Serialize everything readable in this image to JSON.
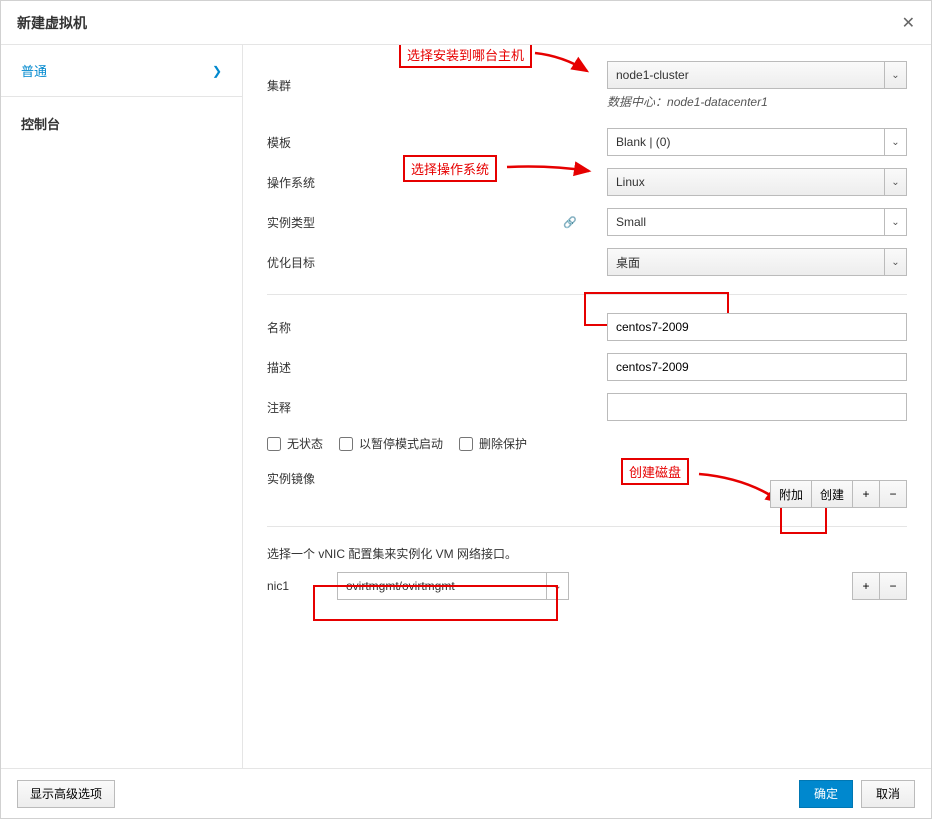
{
  "dialog": {
    "title": "新建虚拟机"
  },
  "sidebar": {
    "items": [
      {
        "label": "普通",
        "active": true
      },
      {
        "label": "控制台",
        "active": false
      }
    ]
  },
  "annotations": {
    "cluster_hint": "选择安装到哪台主机",
    "os_hint": "选择操作系统",
    "disk_hint": "创建磁盘"
  },
  "form": {
    "cluster_label": "集群",
    "cluster_value": "node1-cluster",
    "datacenter_label": "数据中心：",
    "datacenter_value": "node1-datacenter1",
    "template_label": "模板",
    "template_value": "Blank |  (0)",
    "os_label": "操作系统",
    "os_value": "Linux",
    "instance_type_label": "实例类型",
    "instance_type_value": "Small",
    "optimize_label": "优化目标",
    "optimize_value": "桌面",
    "name_label": "名称",
    "name_value": "centos7-2009",
    "desc_label": "描述",
    "desc_value": "centos7-2009",
    "comment_label": "注释",
    "comment_value": "",
    "stateless_label": "无状态",
    "pause_label": "以暂停模式启动",
    "delete_protect_label": "删除保护",
    "instance_image_label": "实例镜像",
    "attach_btn": "附加",
    "create_btn": "创建",
    "nic_desc": "选择一个 vNIC 配置集来实例化 VM 网络接口。",
    "nic1_label": "nic1",
    "nic1_value": "ovirtmgmt/ovirtmgmt"
  },
  "footer": {
    "advanced": "显示高级选项",
    "ok": "确定",
    "cancel": "取消"
  },
  "icons": {
    "plus": "+",
    "minus": "−"
  }
}
